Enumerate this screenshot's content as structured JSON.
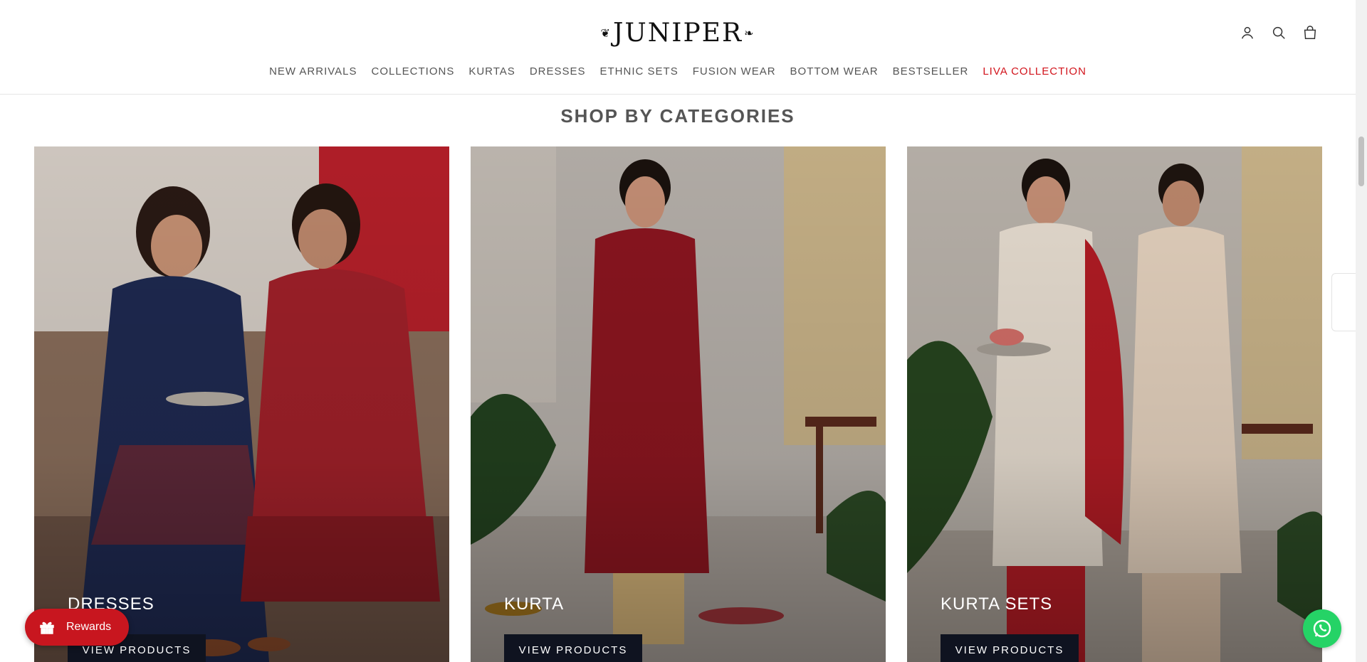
{
  "header": {
    "logo_text": "JUNIPER",
    "nav": [
      {
        "label": "NEW ARRIVALS"
      },
      {
        "label": "COLLECTIONS"
      },
      {
        "label": "KURTAS"
      },
      {
        "label": "DRESSES"
      },
      {
        "label": "ETHNIC SETS"
      },
      {
        "label": "FUSION WEAR"
      },
      {
        "label": "BOTTOM WEAR"
      },
      {
        "label": "BESTSELLER"
      },
      {
        "label": "LIVA COLLECTION"
      }
    ],
    "icons": [
      "user-icon",
      "search-icon",
      "bag-icon"
    ],
    "accent_color": "#d2141c"
  },
  "section": {
    "title": "SHOP BY CATEGORIES"
  },
  "categories": [
    {
      "label": "DRESSES",
      "button": "VIEW PRODUCTS"
    },
    {
      "label": "KURTA",
      "button": "VIEW PRODUCTS"
    },
    {
      "label": "KURTA SETS",
      "button": "VIEW PRODUCTS"
    }
  ],
  "widgets": {
    "rewards_label": "Rewards",
    "rewards_color": "#c8161f",
    "whatsapp_color": "#25d366"
  }
}
